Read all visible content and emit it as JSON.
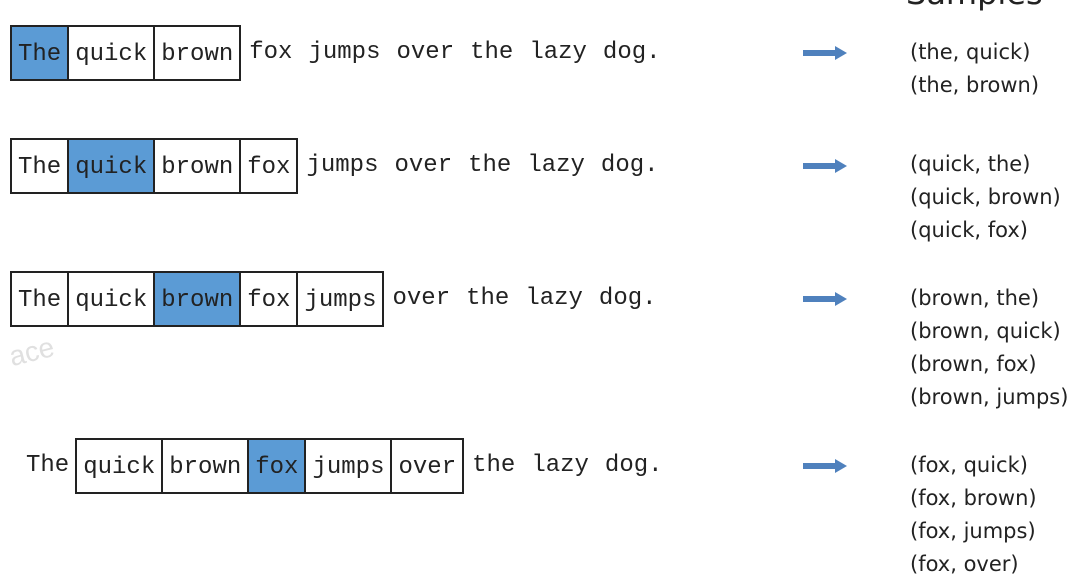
{
  "heading": "Samples",
  "watermark": "ace",
  "arrow_color": "#4f81bd",
  "center_color": "#5b9bd5",
  "rows": [
    {
      "tokens": [
        {
          "text": "The",
          "boxed": true,
          "center": true
        },
        {
          "text": "quick",
          "boxed": true,
          "center": false
        },
        {
          "text": "brown",
          "boxed": true,
          "center": false
        },
        {
          "text": "fox",
          "boxed": false,
          "center": false
        },
        {
          "text": "jumps",
          "boxed": false,
          "center": false
        },
        {
          "text": "over",
          "boxed": false,
          "center": false
        },
        {
          "text": "the",
          "boxed": false,
          "center": false
        },
        {
          "text": "lazy",
          "boxed": false,
          "center": false
        },
        {
          "text": "dog.",
          "boxed": false,
          "center": false
        }
      ],
      "pairs": [
        "(the, quick)",
        "(the, brown)"
      ]
    },
    {
      "tokens": [
        {
          "text": "The",
          "boxed": true,
          "center": false
        },
        {
          "text": "quick",
          "boxed": true,
          "center": true
        },
        {
          "text": "brown",
          "boxed": true,
          "center": false
        },
        {
          "text": "fox",
          "boxed": true,
          "center": false
        },
        {
          "text": "jumps",
          "boxed": false,
          "center": false
        },
        {
          "text": "over",
          "boxed": false,
          "center": false
        },
        {
          "text": "the",
          "boxed": false,
          "center": false
        },
        {
          "text": "lazy",
          "boxed": false,
          "center": false
        },
        {
          "text": "dog.",
          "boxed": false,
          "center": false
        }
      ],
      "pairs": [
        "(quick, the)",
        "(quick, brown)",
        "(quick, fox)"
      ]
    },
    {
      "tokens": [
        {
          "text": "The",
          "boxed": true,
          "center": false
        },
        {
          "text": "quick",
          "boxed": true,
          "center": false
        },
        {
          "text": "brown",
          "boxed": true,
          "center": true
        },
        {
          "text": "fox",
          "boxed": true,
          "center": false
        },
        {
          "text": "jumps",
          "boxed": true,
          "center": false
        },
        {
          "text": "over",
          "boxed": false,
          "center": false
        },
        {
          "text": "the",
          "boxed": false,
          "center": false
        },
        {
          "text": "lazy",
          "boxed": false,
          "center": false
        },
        {
          "text": "dog.",
          "boxed": false,
          "center": false
        }
      ],
      "pairs": [
        "(brown, the)",
        "(brown, quick)",
        "(brown, fox)",
        "(brown, jumps)"
      ]
    },
    {
      "tokens": [
        {
          "text": "The",
          "boxed": false,
          "center": false
        },
        {
          "text": "quick",
          "boxed": true,
          "center": false
        },
        {
          "text": "brown",
          "boxed": true,
          "center": false
        },
        {
          "text": "fox",
          "boxed": true,
          "center": true
        },
        {
          "text": "jumps",
          "boxed": true,
          "center": false
        },
        {
          "text": "over",
          "boxed": true,
          "center": false
        },
        {
          "text": "the",
          "boxed": false,
          "center": false
        },
        {
          "text": "lazy",
          "boxed": false,
          "center": false
        },
        {
          "text": "dog.",
          "boxed": false,
          "center": false
        }
      ],
      "pairs": [
        "(fox, quick)",
        "(fox, brown)",
        "(fox, jumps)",
        "(fox, over)"
      ]
    }
  ]
}
